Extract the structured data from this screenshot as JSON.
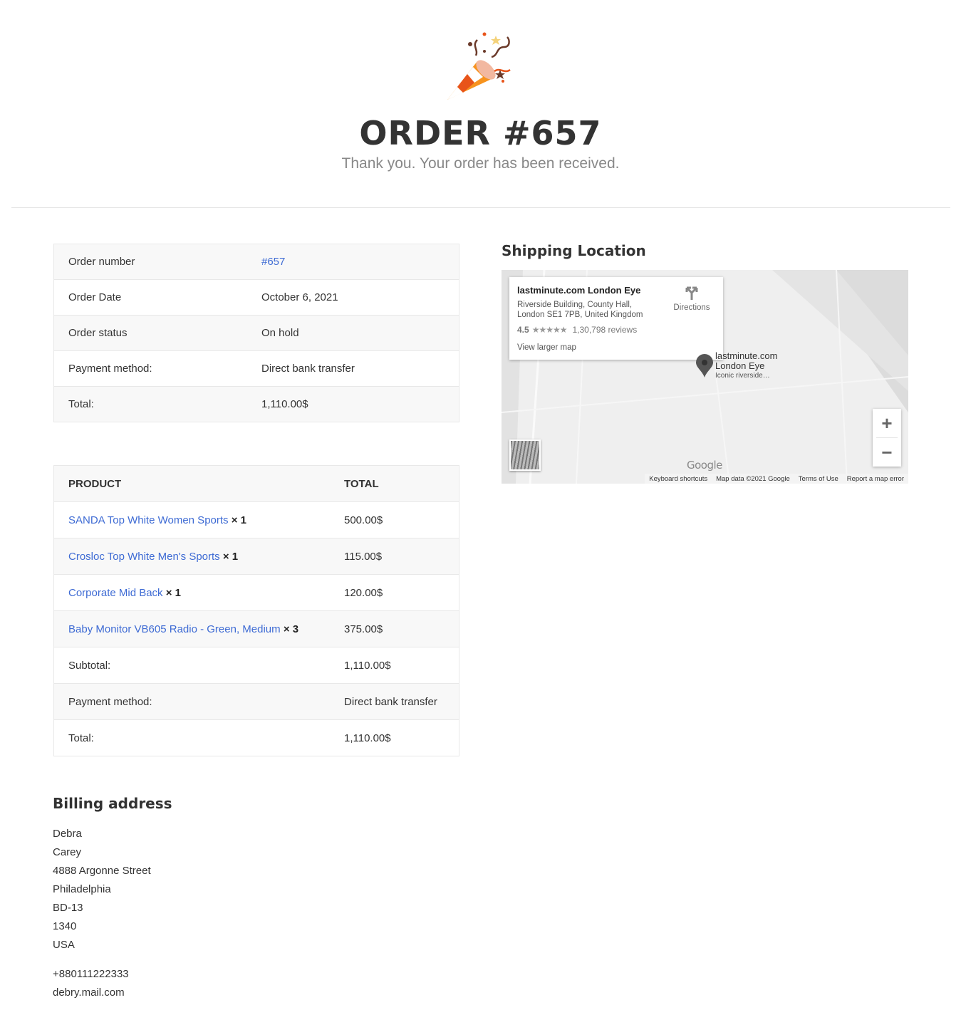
{
  "hero": {
    "title": "ORDER #657",
    "subtitle": "Thank you. Your order has been received."
  },
  "order_info": [
    {
      "label": "Order number",
      "value": "#657"
    },
    {
      "label": "Order Date",
      "value": "October 6, 2021"
    },
    {
      "label": "Order status",
      "value": "On hold"
    },
    {
      "label": "Payment method:",
      "value": "Direct bank transfer"
    },
    {
      "label": "Total:",
      "value": "1,110.00$"
    }
  ],
  "products": {
    "header": {
      "product": "PRODUCT",
      "total": "TOTAL"
    },
    "items": [
      {
        "name": "SANDA Top White Women Sports",
        "qty": "× 1",
        "total": "500.00$"
      },
      {
        "name": "Crosloc Top White Men's Sports",
        "qty": "× 1",
        "total": "115.00$"
      },
      {
        "name": "Corporate Mid Back",
        "qty": "× 1",
        "total": "120.00$"
      },
      {
        "name": "Baby Monitor VB605 Radio - Green, Medium",
        "qty": "× 3",
        "total": "375.00$"
      }
    ],
    "summary": [
      {
        "label": "Subtotal:",
        "value": "1,110.00$"
      },
      {
        "label": "Payment method:",
        "value": "Direct bank transfer"
      },
      {
        "label": "Total:",
        "value": "1,110.00$"
      }
    ]
  },
  "shipping": {
    "title": "Shipping Location",
    "map": {
      "place_name": "lastminute.com London Eye",
      "address_line1": "Riverside Building, County Hall,",
      "address_line2": "London SE1 7PB, United Kingdom",
      "rating": "4.5",
      "stars": "★★★★★",
      "reviews": "1,30,798 reviews",
      "view_larger": "View larger map",
      "directions": "Directions",
      "pin_line1": "lastminute.com",
      "pin_line2": "London Eye",
      "pin_line3": "Iconic riverside…",
      "logo": "Google",
      "attribution": [
        "Keyboard shortcuts",
        "Map data ©2021 Google",
        "Terms of Use",
        "Report a map error"
      ],
      "zoom_in": "+",
      "zoom_out": "−"
    }
  },
  "billing": {
    "title": "Billing address",
    "lines": [
      "Debra",
      "Carey",
      "4888 Argonne Street",
      "Philadelphia",
      "BD-13",
      "1340",
      "USA"
    ],
    "phone": "+880111222333",
    "email": "debry.mail.com"
  }
}
